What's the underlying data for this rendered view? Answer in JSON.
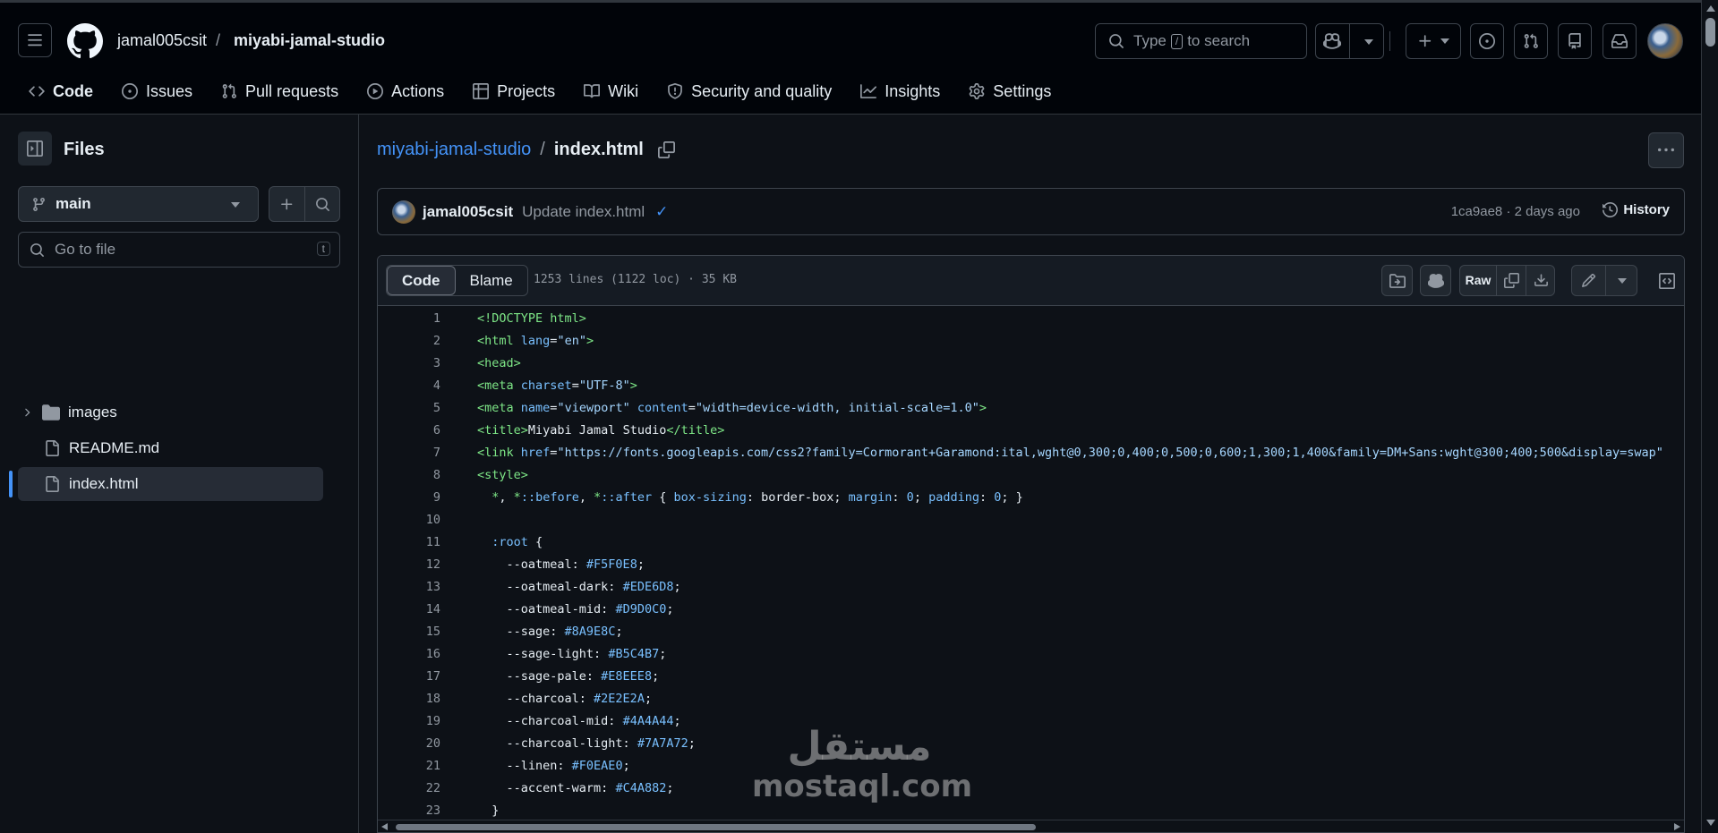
{
  "header": {
    "owner": "jamal005csit",
    "separator": "/",
    "repo": "miyabi-jamal-studio",
    "search": {
      "prefix": "Type",
      "key": "/",
      "suffix": "to search"
    }
  },
  "repo_nav": [
    {
      "label": "Code",
      "icon": "code-icon",
      "active": true
    },
    {
      "label": "Issues",
      "icon": "issue-icon"
    },
    {
      "label": "Pull requests",
      "icon": "pull-request-icon"
    },
    {
      "label": "Actions",
      "icon": "play-icon"
    },
    {
      "label": "Projects",
      "icon": "table-icon"
    },
    {
      "label": "Wiki",
      "icon": "book-icon"
    },
    {
      "label": "Security and quality",
      "icon": "shield-icon"
    },
    {
      "label": "Insights",
      "icon": "graph-icon"
    },
    {
      "label": "Settings",
      "icon": "gear-icon"
    }
  ],
  "sidebar": {
    "title": "Files",
    "branch": "main",
    "goto_placeholder": "Go to file",
    "goto_key": "t",
    "tree": [
      {
        "name": "images",
        "type": "folder"
      },
      {
        "name": "README.md",
        "type": "file"
      },
      {
        "name": "index.html",
        "type": "file",
        "selected": true
      }
    ]
  },
  "main": {
    "repo_link": "miyabi-jamal-studio",
    "separator": "/",
    "file_name": "index.html",
    "commit": {
      "author": "jamal005csit",
      "message": "Update index.html",
      "check": "✓",
      "meta": "1ca9ae8 · 2 days ago",
      "history_label": "History"
    },
    "file": {
      "tab_code": "Code",
      "tab_blame": "Blame",
      "info": "1253 lines (1122 loc) · 35 KB",
      "raw_label": "Raw"
    },
    "code_lines": [
      {
        "n": "1",
        "html": "<span class=\"t-tag\">&lt;!DOCTYPE html&gt;</span>"
      },
      {
        "n": "2",
        "html": "<span class=\"t-tag\">&lt;html</span> <span class=\"t-attr\">lang</span>=<span class=\"t-str\">\"en\"</span><span class=\"t-tag\">&gt;</span>"
      },
      {
        "n": "3",
        "html": "<span class=\"t-tag\">&lt;head&gt;</span>"
      },
      {
        "n": "4",
        "html": "<span class=\"t-tag\">&lt;meta</span> <span class=\"t-attr\">charset</span>=<span class=\"t-str\">\"UTF-8\"</span><span class=\"t-tag\">&gt;</span>"
      },
      {
        "n": "5",
        "html": "<span class=\"t-tag\">&lt;meta</span> <span class=\"t-attr\">name</span>=<span class=\"t-str\">\"viewport\"</span> <span class=\"t-attr\">content</span>=<span class=\"t-str\">\"width=device-width, initial-scale=1.0\"</span><span class=\"t-tag\">&gt;</span>"
      },
      {
        "n": "6",
        "html": "<span class=\"t-tag\">&lt;title&gt;</span>Miyabi Jamal Studio<span class=\"t-tag\">&lt;/title&gt;</span>"
      },
      {
        "n": "7",
        "html": "<span class=\"t-tag\">&lt;link</span> <span class=\"t-attr\">href</span>=<span class=\"t-str\">\"https://fonts.googleapis.com/css2?family=Cormorant+Garamond:ital,wght@0,300;0,400;0,500;0,600;1,300;1,400&amp;family=DM+Sans:wght@300;400;500&amp;display=swap\"</span>"
      },
      {
        "n": "8",
        "html": "<span class=\"t-tag\">&lt;style&gt;</span>"
      },
      {
        "n": "9",
        "html": "  <span class=\"t-tag\">*</span>, <span class=\"t-tag\">*</span><span class=\"t-kw\">::before</span>, <span class=\"t-tag\">*</span><span class=\"t-kw\">::after</span> { <span class=\"t-attr\">box-sizing</span>: border-box; <span class=\"t-attr\">margin</span>: <span class=\"t-kw\">0</span>; <span class=\"t-attr\">padding</span>: <span class=\"t-kw\">0</span>; }"
      },
      {
        "n": "10",
        "html": ""
      },
      {
        "n": "11",
        "html": "  <span class=\"t-kw\">:root</span> {"
      },
      {
        "n": "12",
        "html": "    --oatmeal: <span class=\"t-kw\">#F5F0E8</span>;"
      },
      {
        "n": "13",
        "html": "    --oatmeal-dark: <span class=\"t-kw\">#EDE6D8</span>;"
      },
      {
        "n": "14",
        "html": "    --oatmeal-mid: <span class=\"t-kw\">#D9D0C0</span>;"
      },
      {
        "n": "15",
        "html": "    --sage: <span class=\"t-kw\">#8A9E8C</span>;"
      },
      {
        "n": "16",
        "html": "    --sage-light: <span class=\"t-kw\">#B5C4B7</span>;"
      },
      {
        "n": "17",
        "html": "    --sage-pale: <span class=\"t-kw\">#E8EEE8</span>;"
      },
      {
        "n": "18",
        "html": "    --charcoal: <span class=\"t-kw\">#2E2E2A</span>;"
      },
      {
        "n": "19",
        "html": "    --charcoal-mid: <span class=\"t-kw\">#4A4A44</span>;"
      },
      {
        "n": "20",
        "html": "    --charcoal-light: <span class=\"t-kw\">#7A7A72</span>;"
      },
      {
        "n": "21",
        "html": "    --linen: <span class=\"t-kw\">#F0EAE0</span>;"
      },
      {
        "n": "22",
        "html": "    --accent-warm: <span class=\"t-kw\">#C4A882</span>;"
      },
      {
        "n": "23",
        "html": "  }"
      }
    ]
  },
  "watermark": {
    "top": "مستقل",
    "bottom": "mostaql.com"
  },
  "colors": {
    "accent": "#4493f8",
    "nav_underline": "#f78166",
    "bg": "#0d1117",
    "header_bg": "#010409"
  }
}
